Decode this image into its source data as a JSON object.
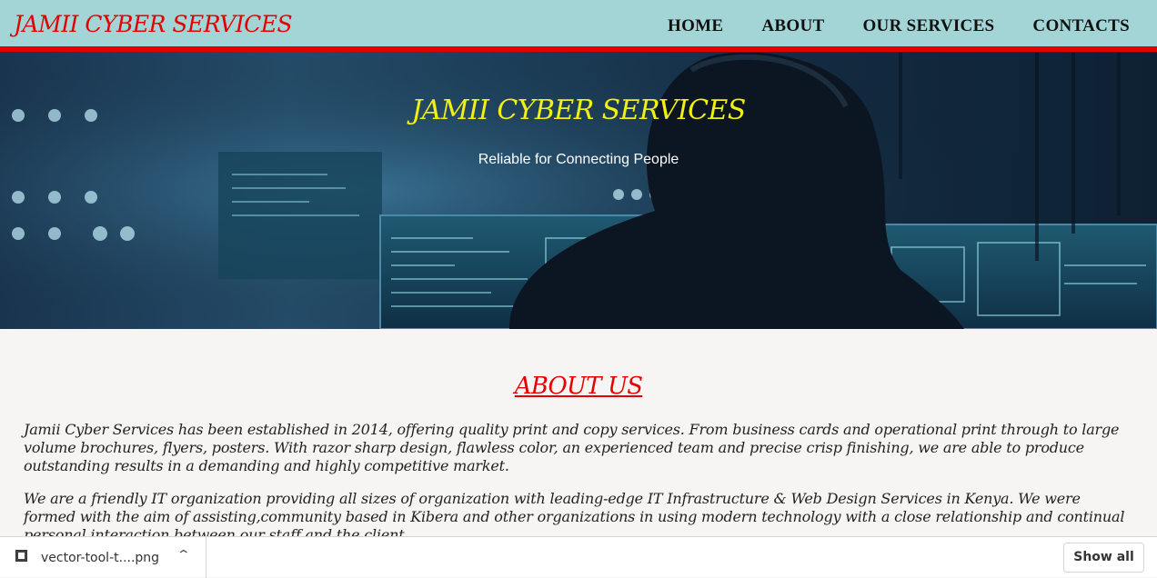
{
  "navbar": {
    "brand": "JAMII CYBER SERVICES",
    "links": [
      "HOME",
      "ABOUT",
      "OUR SERVICES",
      "CONTACTS"
    ],
    "background_color": "#a4d5d6",
    "accent_color": "#e50000"
  },
  "hero": {
    "title": "JAMII CYBER SERVICES",
    "subtitle": "Reliable for Connecting People",
    "title_color": "#f2ef14"
  },
  "about": {
    "heading": "ABOUT US",
    "paragraphs": [
      "Jamii Cyber Services has been established in 2014, offering quality print and copy services. From business cards and operational print through to large volume brochures, flyers, posters. With razor sharp design, flawless color, an experienced team and precise crisp finishing, we are able to produce outstanding results in a demanding and highly competitive market.",
      "We are a friendly IT organization providing all sizes of organization with leading-edge IT Infrastructure & Web Design Services in Kenya. We were formed with the aim of assisting,community based in Kibera and other organizations in using modern technology with a close relationship and continual personal interaction between our staff and the client."
    ]
  },
  "download_bar": {
    "file_name": "vector-tool-t....png",
    "file_icon": "image-file-icon",
    "chevron_icon": "chevron-up-icon",
    "show_all_label": "Show all"
  }
}
